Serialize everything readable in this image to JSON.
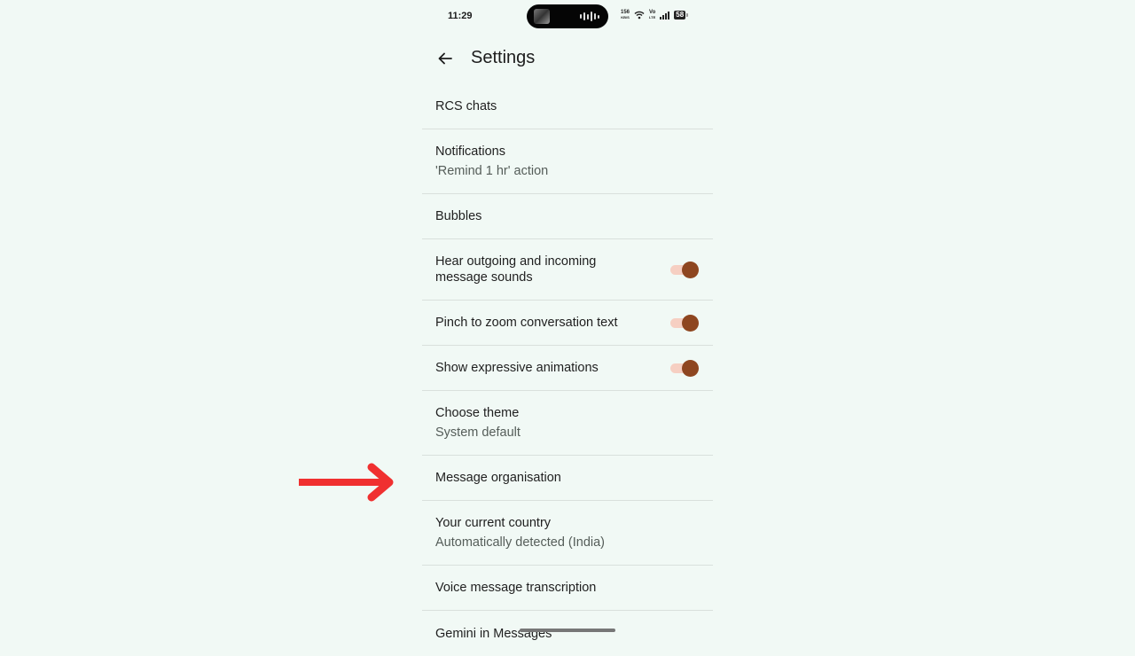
{
  "status_bar": {
    "time": "11:29",
    "net_speed_value": "156",
    "net_speed_unit": "KB/S",
    "volte_top": "Vo",
    "volte_bottom": "LTE",
    "battery": "58"
  },
  "app_bar": {
    "back_icon": "arrow-back-icon",
    "title": "Settings"
  },
  "settings": [
    {
      "title": "RCS chats"
    },
    {
      "title": "Notifications",
      "subtitle": "'Remind 1 hr' action"
    },
    {
      "title": "Bubbles"
    },
    {
      "title": "Hear outgoing and incoming message sounds",
      "toggle": true
    },
    {
      "title": "Pinch to zoom conversation text",
      "toggle": true
    },
    {
      "title": "Show expressive animations",
      "toggle": true
    },
    {
      "title": "Choose theme",
      "subtitle": "System default"
    },
    {
      "title": "Message organisation"
    },
    {
      "title": "Your current country",
      "subtitle": "Automatically detected (India)"
    },
    {
      "title": "Voice message transcription"
    },
    {
      "title": "Gemini in Messages"
    }
  ],
  "colors": {
    "background": "#f1f9f5",
    "toggle_thumb": "#8e4620",
    "toggle_track": "#f6cfc2",
    "annotation_arrow": "#f03030"
  },
  "annotation": {
    "icon": "red-arrow-icon",
    "points_to": "Message organisation"
  }
}
